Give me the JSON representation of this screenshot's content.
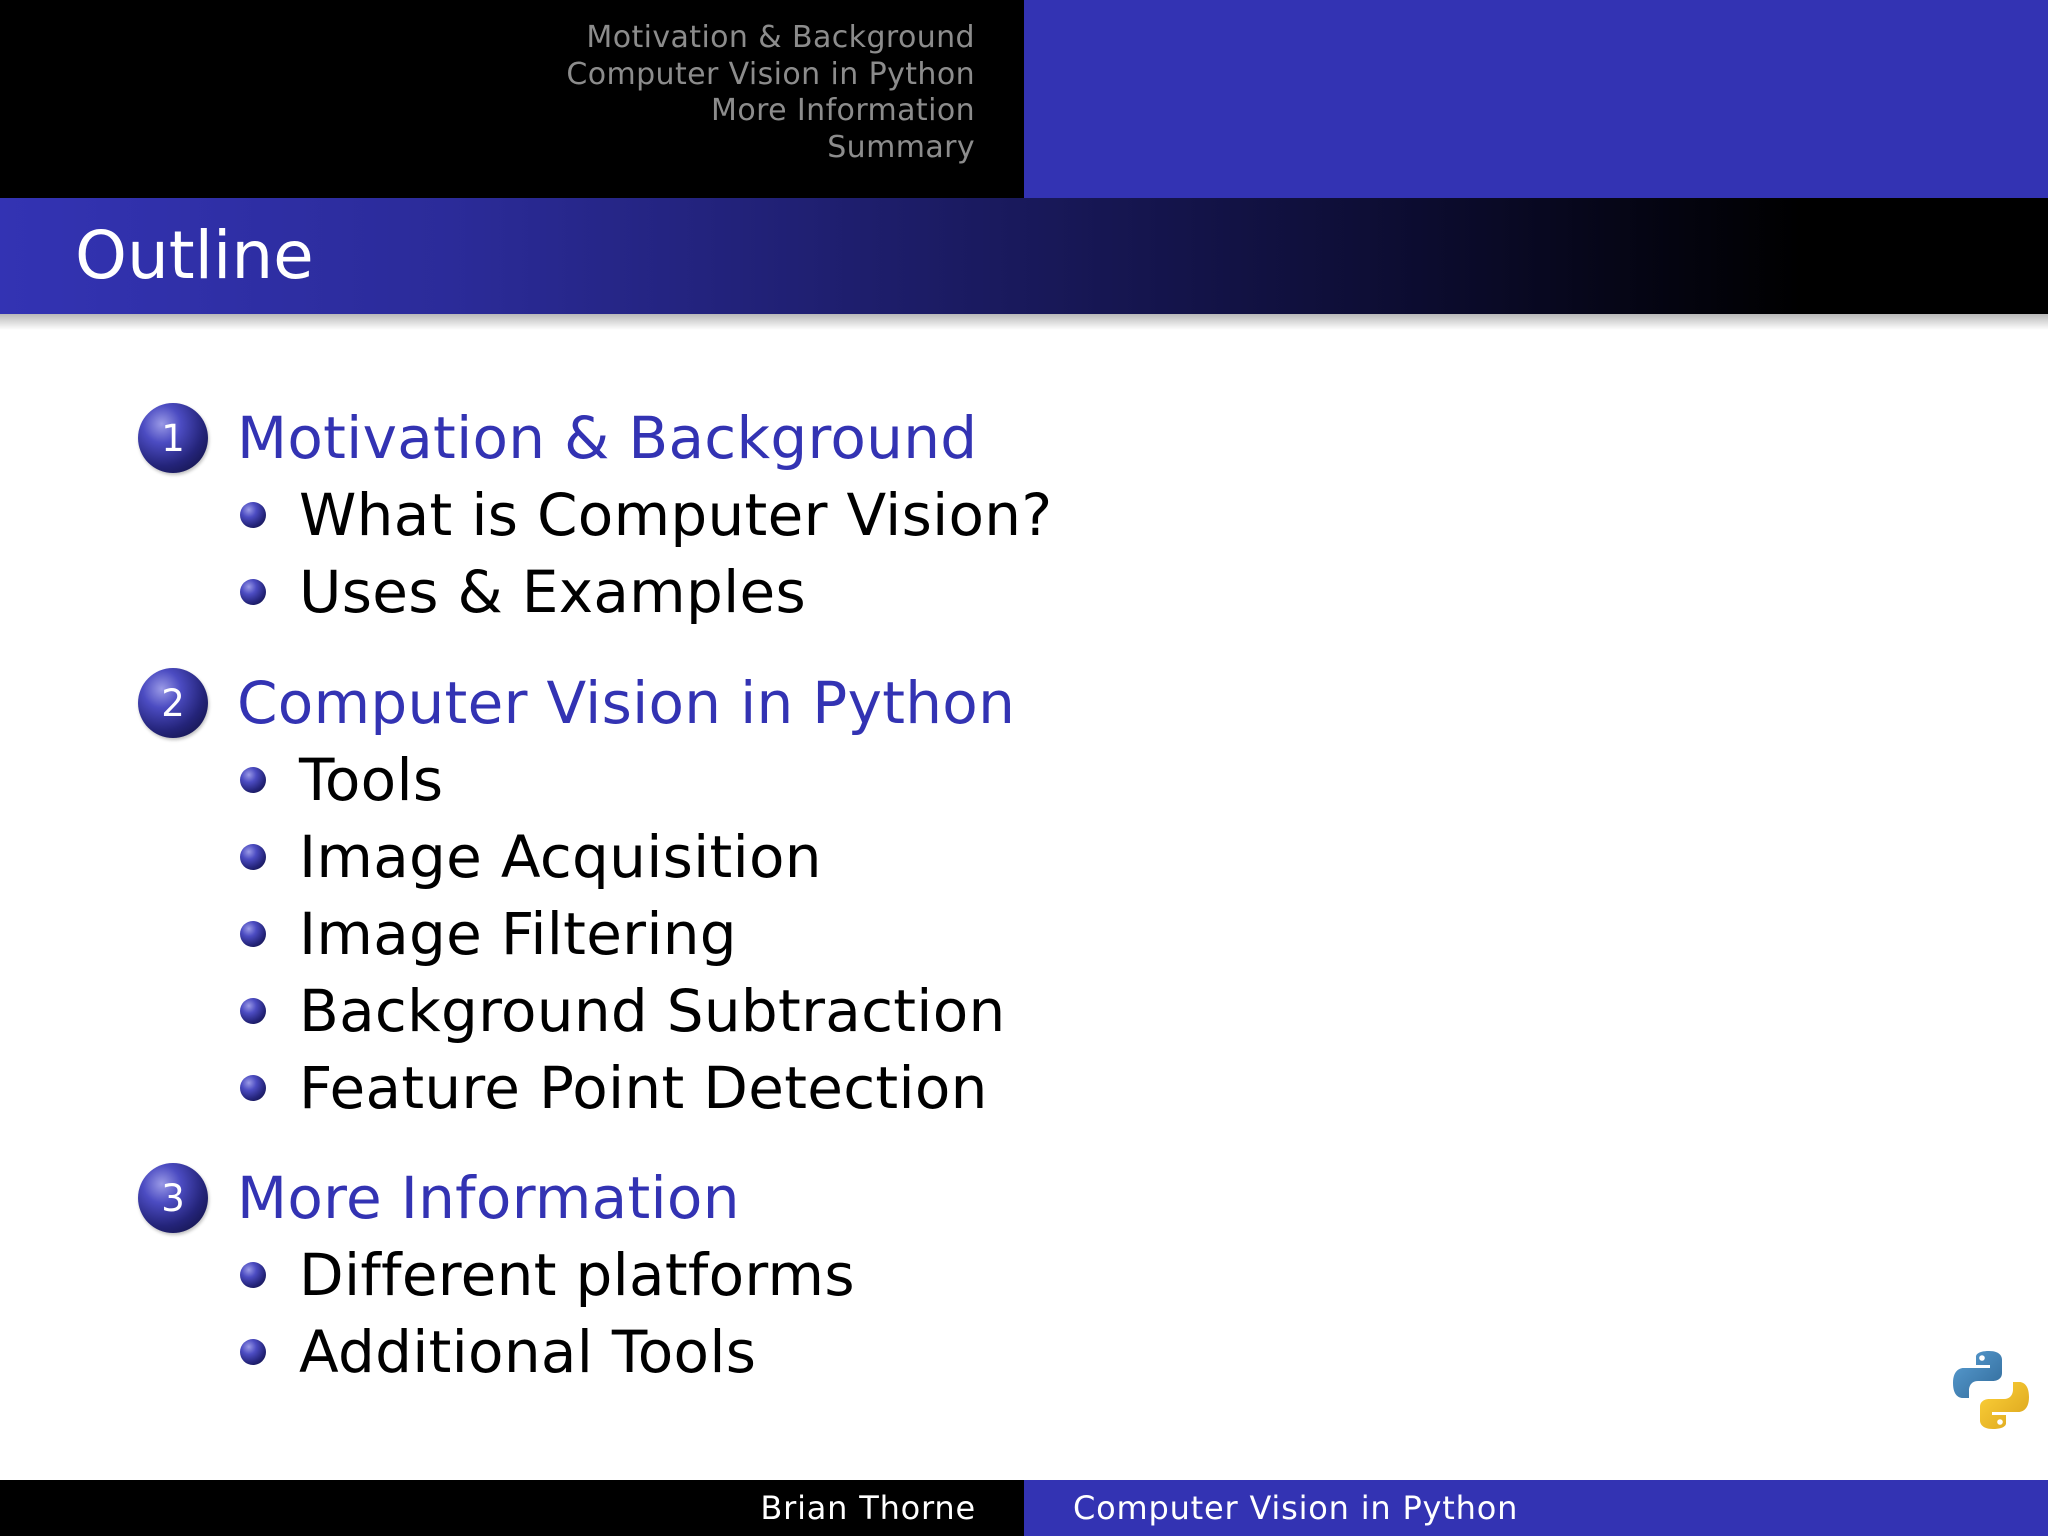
{
  "header": {
    "sections": [
      "Motivation & Background",
      "Computer Vision in Python",
      "More Information",
      "Summary"
    ]
  },
  "frame": {
    "title": "Outline"
  },
  "outline": [
    {
      "number": "1",
      "title": "Motivation & Background",
      "items": [
        "What is Computer Vision?",
        "Uses & Examples"
      ]
    },
    {
      "number": "2",
      "title": "Computer Vision in Python",
      "items": [
        "Tools",
        "Image Acquisition",
        "Image Filtering",
        "Background Subtraction",
        "Feature Point Detection"
      ]
    },
    {
      "number": "3",
      "title": "More Information",
      "items": [
        "Different platforms",
        "Additional Tools"
      ]
    }
  ],
  "logo": {
    "icon": "python-logo-icon",
    "colors": {
      "blue": "#3776ab",
      "yellow": "#ffd43b"
    }
  },
  "footer": {
    "author": "Brian Thorne",
    "title": "Computer Vision in Python"
  },
  "theme": {
    "structure": "#3333b3",
    "background": "#ffffff",
    "headline_dark": "#000000",
    "nav_text": "#8c8c8c"
  }
}
